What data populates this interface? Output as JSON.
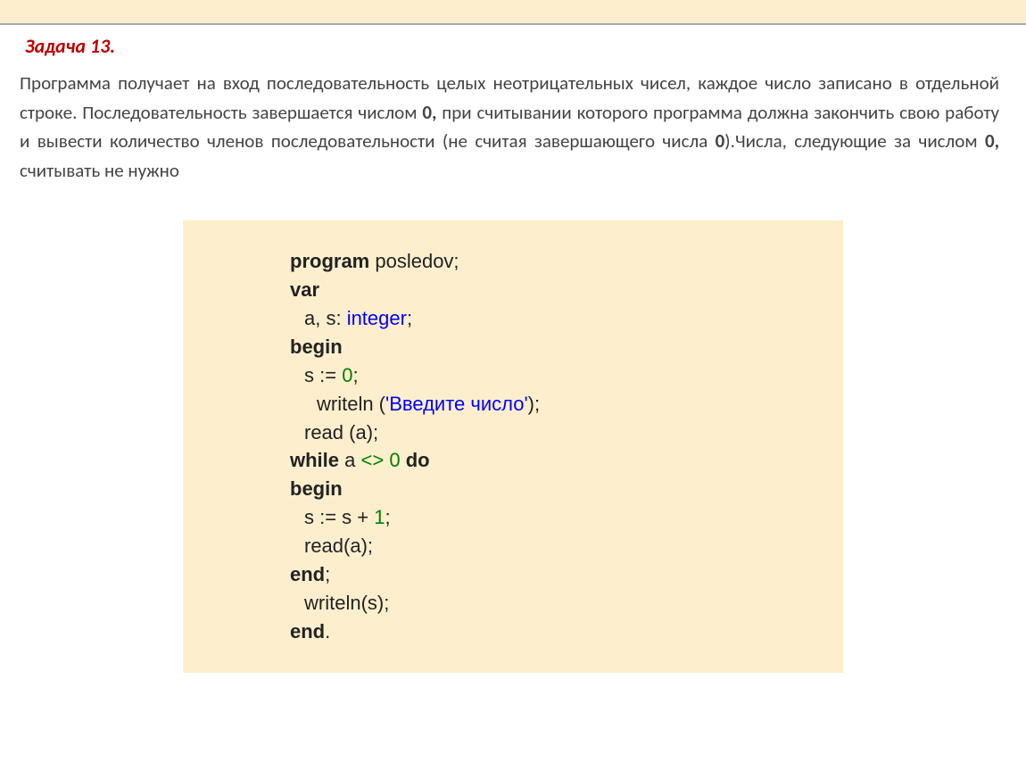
{
  "title": "Задача 13.",
  "description_parts": {
    "p1": "Программа получает на вход последовательность целых неотрицательных чисел, каждое число записано в отдельной строке. Последовательность завершается числом ",
    "b1": "0,",
    "p2": " при считывании которого программа должна закончить свою работу и вывести количество членов последовательности (не считая завершающего числа ",
    "b2": "0",
    "p3": ").Числа, следующие за числом ",
    "b3": "0,",
    "p4": " считывать не нужно"
  },
  "code": {
    "l1_kw": "program",
    "l1_rest": " posledov;",
    "l2_kw": "var",
    "l3_pre": "a, s: ",
    "l3_type": "integer",
    "l3_post": ";",
    "l4_kw": "begin",
    "l5_pre": "s := ",
    "l5_num": "0",
    "l5_post": ";",
    "l6_pre": "writeln (",
    "l6_str": "'Введите число'",
    "l6_post": ");",
    "l7": "read (a);",
    "l8_kw1": "while",
    "l8_mid1": " a ",
    "l8_op": "<>",
    "l8_sp": " ",
    "l8_num": "0",
    "l8_sp2": " ",
    "l8_kw2": "do",
    "l9_kw": "begin",
    "l10_pre": "s := s + ",
    "l10_num": "1",
    "l10_post": ";",
    "l11": "read(a);",
    "l12_kw": "end",
    "l12_post": ";",
    "l13": "writeln(s);",
    "l14_kw": "end",
    "l14_post": "."
  }
}
